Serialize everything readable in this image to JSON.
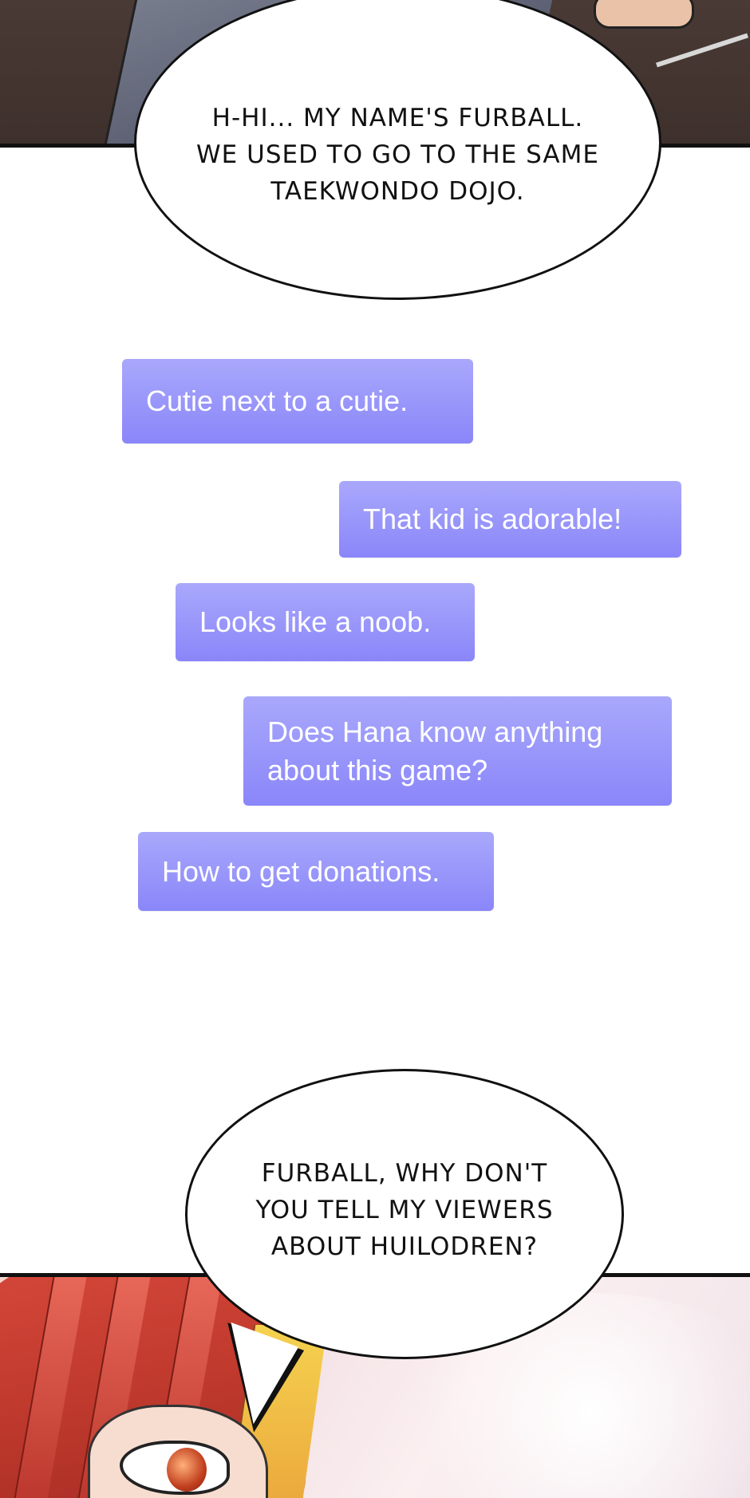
{
  "panels": {
    "top_bubble": {
      "text": "H-HI... MY NAME'S FURBALL.\nWE USED TO GO TO THE SAME\nTAEKWONDO DOJO."
    },
    "bottom_bubble": {
      "text": "FURBALL, WHY DON'T\nYOU TELL MY VIEWERS\nABOUT HUILODREN?"
    }
  },
  "chat": {
    "messages": [
      {
        "text": "Cutie next to a cutie."
      },
      {
        "text": "That kid is adorable!"
      },
      {
        "text": "Looks like a noob."
      },
      {
        "text": "Does Hana know anything\nabout this game?"
      },
      {
        "text": "How to get donations."
      }
    ],
    "bubble_color": "#8f8cfa",
    "text_color": "#ffffff"
  }
}
